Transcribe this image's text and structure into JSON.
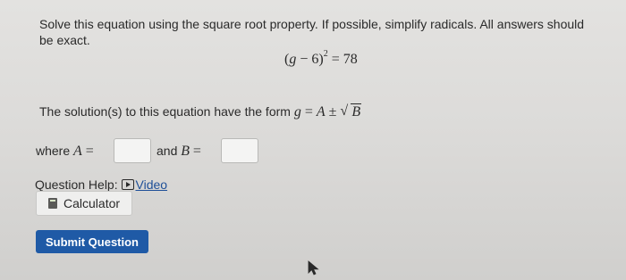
{
  "question": {
    "instructions_line1": "Solve this equation using the square root property. If possible, simplify radicals. All answers should",
    "instructions_line2": "be exact.",
    "equation": {
      "open_paren": "(",
      "variable": "g",
      "minus": " − 6)",
      "exponent": "2",
      "equals": " = 78"
    },
    "form_text": "The solution(s) to this equation have the form",
    "form_expr": {
      "lhs": "g",
      "eq": " = ",
      "A": "A",
      "pm": " ± ",
      "radical": "√",
      "B": "B"
    },
    "where_label": "where",
    "A_label": "A",
    "B_label": "B",
    "eq_sign": "=",
    "and_label": "and",
    "A_value": "",
    "B_value": ""
  },
  "help": {
    "label": "Question Help:",
    "video_link": "Video",
    "calculator_label": "Calculator"
  },
  "actions": {
    "submit_label": "Submit Question"
  }
}
